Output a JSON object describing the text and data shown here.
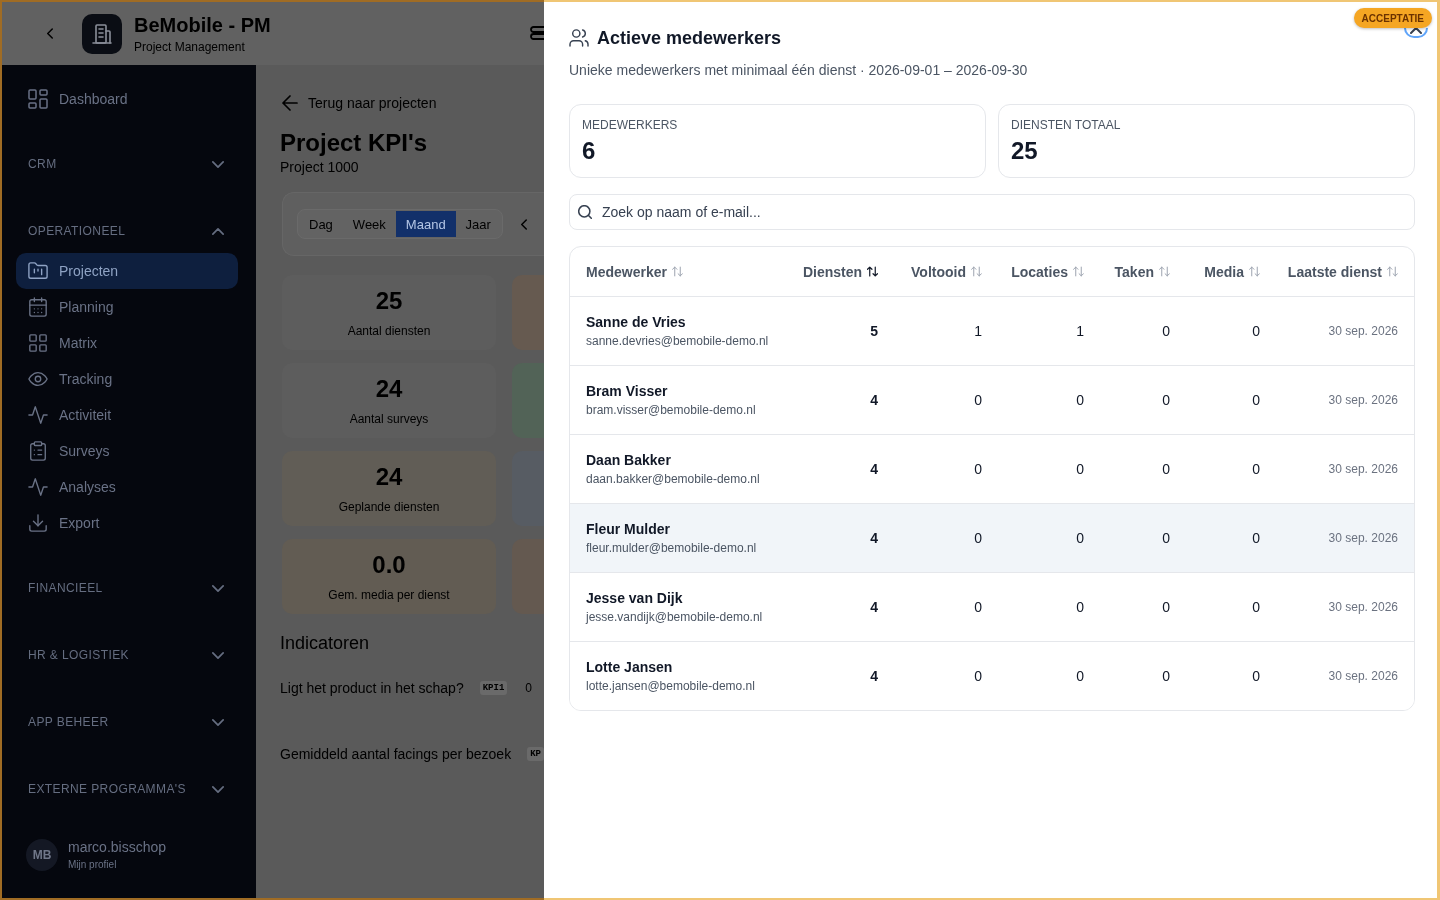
{
  "app_header": {
    "title": "BeMobile - PM",
    "subtitle": "Project Management"
  },
  "sidebar": {
    "items": [
      {
        "label": "Dashboard",
        "selected": false
      }
    ],
    "sections": [
      {
        "label": "CRM",
        "expanded": false
      },
      {
        "label": "OPERATIONEEL",
        "expanded": true,
        "items": [
          {
            "label": "Projecten",
            "selected": true
          },
          {
            "label": "Planning",
            "selected": false
          },
          {
            "label": "Matrix",
            "selected": false
          },
          {
            "label": "Tracking",
            "selected": false
          },
          {
            "label": "Activiteit",
            "selected": false
          },
          {
            "label": "Surveys",
            "selected": false
          },
          {
            "label": "Analyses",
            "selected": false
          },
          {
            "label": "Export",
            "selected": false
          }
        ]
      },
      {
        "label": "FINANCIEEL",
        "expanded": false
      },
      {
        "label": "HR & LOGISTIEK",
        "expanded": false
      },
      {
        "label": "APP BEHEER",
        "expanded": false
      },
      {
        "label": "EXTERNE PROGRAMMA'S",
        "expanded": false
      }
    ],
    "profile": {
      "initials": "MB",
      "name": "marco.bisschop",
      "link": "Mijn profiel"
    }
  },
  "page": {
    "back_link": "Terug naar projecten",
    "title": "Project KPI's",
    "subtitle": "Project 1000",
    "period_tabs": [
      {
        "label": "Dag",
        "selected": false
      },
      {
        "label": "Week",
        "selected": false
      },
      {
        "label": "Maand",
        "selected": true
      },
      {
        "label": "Jaar",
        "selected": false
      }
    ],
    "kpi_cards": [
      {
        "value": "25",
        "label": "Aantal diensten",
        "color": "#5d5d5d"
      },
      {
        "color": "#665a50"
      },
      {
        "value": "24",
        "label": "Aantal surveys",
        "color": "#5d5d5d"
      },
      {
        "color": "#526357"
      },
      {
        "value": "24",
        "label": "Geplande diensten",
        "color": "#615d56"
      },
      {
        "color": "#575c63"
      },
      {
        "value": "0.0",
        "label": "Gem. media per dienst",
        "color": "#625c53"
      },
      {
        "color": "#645950"
      }
    ],
    "indicators_title": "Indicatoren",
    "indicators": [
      {
        "question": "Ligt het product in het schap?",
        "code": "KPI1",
        "value": "0"
      },
      {
        "question": "Gemiddeld aantal facings per bezoek",
        "code": "KP"
      }
    ]
  },
  "environment_badge": "ACCEPTATIE",
  "drawer": {
    "title": "Actieve medewerkers",
    "subtitle": "Unieke medewerkers met minimaal één dienst · 2026-09-01 – 2026-09-30",
    "stats": [
      {
        "label": "MEDEWERKERS",
        "value": "6"
      },
      {
        "label": "DIENSTEN TOTAAL",
        "value": "25"
      }
    ],
    "search": {
      "placeholder": "Zoek op naam of e-mail..."
    },
    "table": {
      "columns": [
        {
          "label": "Medewerker",
          "kind": "person",
          "sorted": false
        },
        {
          "label": "Diensten",
          "kind": "count",
          "sorted": true
        },
        {
          "label": "Voltooid",
          "kind": "number",
          "sorted": false
        },
        {
          "label": "Locaties",
          "kind": "number",
          "sorted": false
        },
        {
          "label": "Taken",
          "kind": "number",
          "sorted": false
        },
        {
          "label": "Media",
          "kind": "number",
          "sorted": false
        },
        {
          "label": "Laatste dienst",
          "kind": "date",
          "sorted": false
        }
      ],
      "rows": [
        {
          "name": "Sanne de Vries",
          "email": "sanne.devries@bemobile-demo.nl",
          "cells": [
            "5",
            "1",
            "1",
            "0",
            "0",
            "30 sep. 2026"
          ],
          "highlighted": false
        },
        {
          "name": "Bram Visser",
          "email": "bram.visser@bemobile-demo.nl",
          "cells": [
            "4",
            "0",
            "0",
            "0",
            "0",
            "30 sep. 2026"
          ],
          "highlighted": false
        },
        {
          "name": "Daan Bakker",
          "email": "daan.bakker@bemobile-demo.nl",
          "cells": [
            "4",
            "0",
            "0",
            "0",
            "0",
            "30 sep. 2026"
          ],
          "highlighted": false
        },
        {
          "name": "Fleur Mulder",
          "email": "fleur.mulder@bemobile-demo.nl",
          "cells": [
            "4",
            "0",
            "0",
            "0",
            "0",
            "30 sep. 2026"
          ],
          "highlighted": true
        },
        {
          "name": "Jesse van Dijk",
          "email": "jesse.vandijk@bemobile-demo.nl",
          "cells": [
            "4",
            "0",
            "0",
            "0",
            "0",
            "30 sep. 2026"
          ],
          "highlighted": false
        },
        {
          "name": "Lotte Jansen",
          "email": "lotte.jansen@bemobile-demo.nl",
          "cells": [
            "4",
            "0",
            "0",
            "0",
            "0",
            "30 sep. 2026"
          ],
          "highlighted": false
        }
      ]
    }
  }
}
